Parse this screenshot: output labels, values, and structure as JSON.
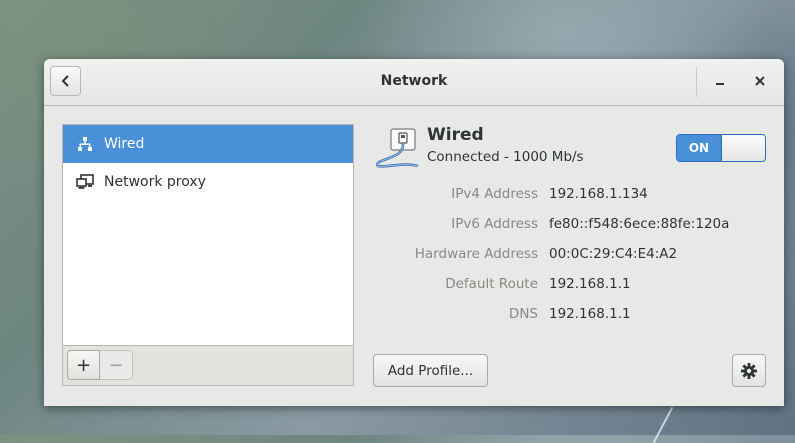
{
  "window": {
    "title": "Network"
  },
  "sidebar": {
    "items": [
      {
        "label": "Wired",
        "icon": "wired-network-icon",
        "selected": true
      },
      {
        "label": "Network proxy",
        "icon": "network-proxy-icon",
        "selected": false
      }
    ],
    "add_label": "+",
    "remove_label": "−"
  },
  "detail": {
    "title": "Wired",
    "status": "Connected - 1000 Mb/s",
    "toggle_label": "ON",
    "properties": [
      {
        "label": "IPv4 Address",
        "value": "192.168.1.134"
      },
      {
        "label": "IPv6 Address",
        "value": "fe80::f548:6ece:88fe:120a"
      },
      {
        "label": "Hardware Address",
        "value": "00:0C:29:C4:E4:A2"
      },
      {
        "label": "Default Route",
        "value": "192.168.1.1"
      },
      {
        "label": "DNS",
        "value": "192.168.1.1"
      }
    ],
    "add_profile_label": "Add Profile..."
  },
  "colors": {
    "accent": "#4a90d9",
    "window_bg": "#e8e8e7"
  }
}
